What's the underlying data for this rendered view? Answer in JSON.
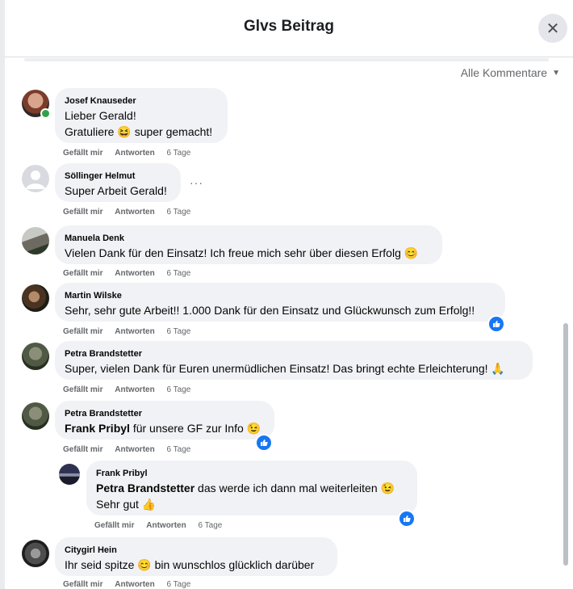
{
  "header": {
    "title": "Glvs Beitrag",
    "close_icon": "close-icon"
  },
  "sort": {
    "label": "Alle Kommentare",
    "icon": "caret-down-icon"
  },
  "actions": {
    "like": "Gefällt mir",
    "reply": "Antworten"
  },
  "comments": [
    {
      "author": "Josef Knauseder",
      "lines": [
        "Lieber Gerald!",
        "Gratuliere",
        "super gemacht!"
      ],
      "time": "6 Tage",
      "emoji": "😆"
    },
    {
      "author": "Söllinger Helmut",
      "text": "Super Arbeit Gerald!",
      "time": "6 Tage",
      "more": "···"
    },
    {
      "author": "Manuela Denk",
      "text": "Vielen Dank für den Einsatz! Ich freue mich sehr über diesen Erfolg",
      "time": "6 Tage",
      "emoji": "😊"
    },
    {
      "author": "Martin Wilske",
      "text": "Sehr, sehr gute Arbeit!! 1.000 Dank für den Einsatz und Glückwunsch zum Erfolg!!",
      "time": "6 Tage",
      "reaction": "like"
    },
    {
      "author": "Petra Brandstetter",
      "text": "Super, vielen Dank für Euren unermüdlichen Einsatz! Das bringt echte Erleichterung!",
      "time": "6 Tage",
      "emoji": "🙏"
    },
    {
      "author": "Petra Brandstetter",
      "mention": "Frank Pribyl",
      "text": "für unsere GF zur Info",
      "time": "6 Tage",
      "emoji": "😉",
      "reaction": "like"
    },
    {
      "author": "Frank Pribyl",
      "mention": "Petra Brandstetter",
      "text": "das werde ich dann mal weiterleiten",
      "line2": "Sehr gut",
      "time": "6 Tage",
      "emoji": "😉",
      "emoji2": "👍",
      "reaction": "like"
    },
    {
      "author": "Citygirl Hein",
      "text": "Ihr seid spitze",
      "text2": "bin wunschlos glücklich darüber",
      "time": "6 Tage",
      "emoji": "😊"
    }
  ]
}
